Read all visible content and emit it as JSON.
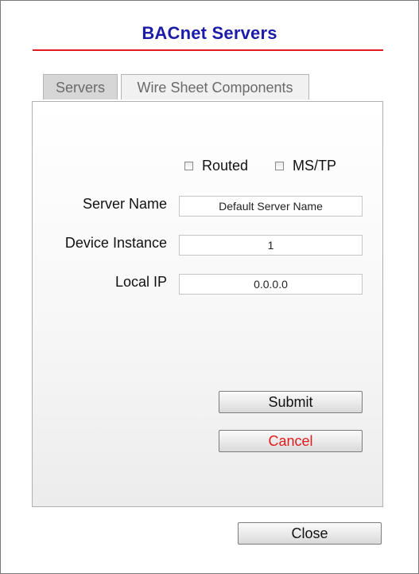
{
  "dialog": {
    "title": "BACnet Servers",
    "title_color": "#1c1ca8",
    "rule_color": "#e01b1b"
  },
  "tabs": [
    {
      "label": "Servers",
      "active": true
    },
    {
      "label": "Wire Sheet Components",
      "active": false
    }
  ],
  "options": {
    "routed": {
      "label": "Routed",
      "checked": false
    },
    "mstp": {
      "label": "MS/TP",
      "checked": false
    }
  },
  "fields": {
    "server_name": {
      "label": "Server Name",
      "value": "Default Server Name"
    },
    "device_instance": {
      "label": "Device Instance",
      "value": "1"
    },
    "local_ip": {
      "label": "Local IP",
      "value": "0.0.0.0"
    }
  },
  "buttons": {
    "submit": "Submit",
    "cancel": "Cancel",
    "close": "Close",
    "cancel_color": "#e01b1b"
  }
}
